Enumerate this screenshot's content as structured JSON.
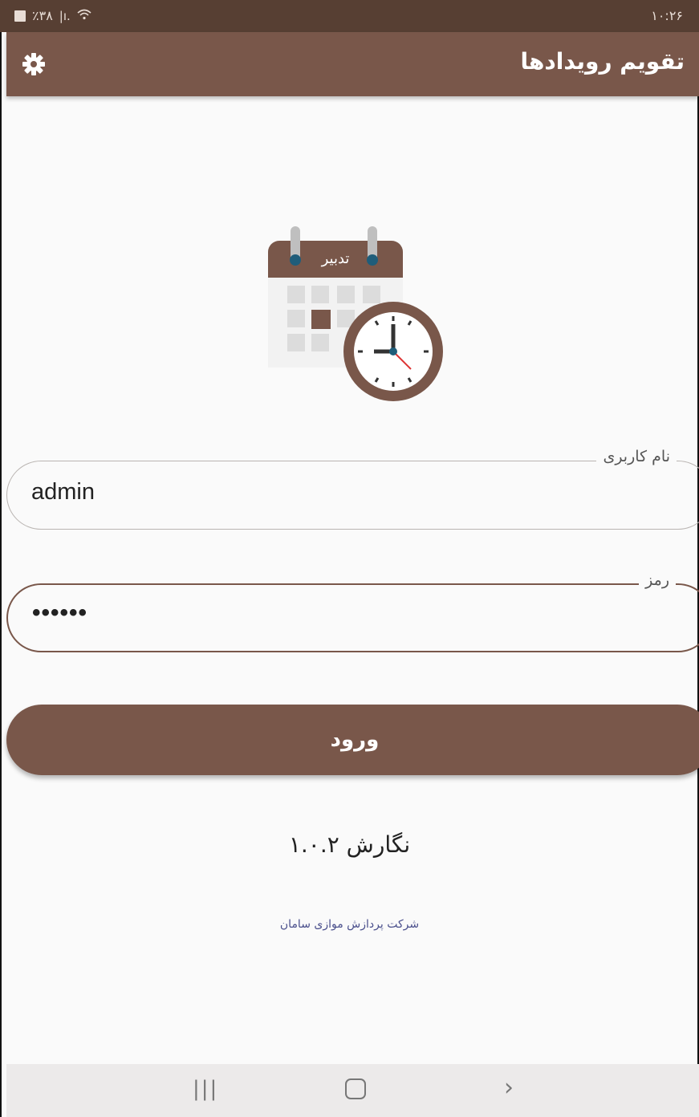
{
  "status_bar": {
    "battery": "٪۳۸",
    "signal": "|ı.",
    "wifi": "wifi",
    "time": "۱۰:۲۶"
  },
  "app_bar": {
    "title": "تقویم رویدادها",
    "settings_icon": "gear-icon"
  },
  "logo": {
    "calendar_header_text": "تدبیر",
    "icon": "calendar-clock-logo"
  },
  "form": {
    "username": {
      "label": "نام کاربری",
      "value": "admin"
    },
    "password": {
      "label": "رمز",
      "value": "••••••"
    },
    "login_button": "ورود"
  },
  "footer": {
    "version": "نگارش ۱.۰.۲",
    "company": "شرکت پردازش موازی سامان"
  },
  "nav": {
    "recent": "|||",
    "back": "›"
  },
  "colors": {
    "primary": "#79574a",
    "status_bar": "#573f33",
    "background": "#fafafa",
    "company_link": "#4a4f8c"
  }
}
